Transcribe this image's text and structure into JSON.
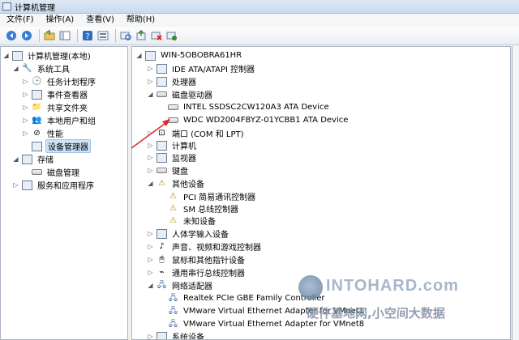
{
  "window": {
    "title": "计算机管理"
  },
  "menu": [
    "文件(F)",
    "操作(A)",
    "查看(V)",
    "帮助(H)"
  ],
  "toolbar": {
    "buttons": [
      "back-icon",
      "forward-icon",
      "up-folder-icon",
      "show-hide-tree-icon",
      "help-icon",
      "properties-icon",
      "scan-hardware-icon",
      "update-driver-icon",
      "disable-device-icon",
      "uninstall-device-icon"
    ]
  },
  "left_tree": [
    {
      "label": "计算机管理(本地)",
      "icon": "computer-icon",
      "expanded": true
    },
    {
      "label": "系统工具",
      "icon": "tools-icon",
      "expanded": true
    },
    {
      "label": "任务计划程序",
      "icon": "clock-icon"
    },
    {
      "label": "事件查看器",
      "icon": "event-viewer-icon"
    },
    {
      "label": "共享文件夹",
      "icon": "shared-folder-icon"
    },
    {
      "label": "本地用户和组",
      "icon": "users-icon"
    },
    {
      "label": "性能",
      "icon": "performance-icon"
    },
    {
      "label": "设备管理器",
      "icon": "device-manager-icon",
      "selected": true
    },
    {
      "label": "存储",
      "icon": "storage-icon",
      "expanded": true
    },
    {
      "label": "磁盘管理",
      "icon": "disk-management-icon"
    },
    {
      "label": "服务和应用程序",
      "icon": "services-icon"
    }
  ],
  "device_tree": [
    {
      "label": "WIN-5OBOBRA61HR",
      "icon": "computer-icon",
      "expanded": true
    },
    {
      "label": "IDE ATA/ATAPI 控制器",
      "icon": "ide-controller-icon"
    },
    {
      "label": "处理器",
      "icon": "processor-icon"
    },
    {
      "label": "磁盘驱动器",
      "icon": "disk-drive-icon",
      "expanded": true
    },
    {
      "label": "INTEL SSDSC2CW120A3 ATA Device",
      "icon": "drive-icon"
    },
    {
      "label": "WDC WD2004FBYZ-01YCBB1 ATA Device",
      "icon": "drive-icon"
    },
    {
      "label": "端口 (COM 和 LPT)",
      "icon": "port-icon"
    },
    {
      "label": "计算机",
      "icon": "computer-icon"
    },
    {
      "label": "监视器",
      "icon": "monitor-icon"
    },
    {
      "label": "键盘",
      "icon": "keyboard-icon"
    },
    {
      "label": "其他设备",
      "icon": "other-devices-icon",
      "expanded": true
    },
    {
      "label": "PCI 简易通讯控制器",
      "icon": "warning-device-icon"
    },
    {
      "label": "SM 总线控制器",
      "icon": "warning-device-icon"
    },
    {
      "label": "未知设备",
      "icon": "warning-device-icon"
    },
    {
      "label": "人体学输入设备",
      "icon": "hid-icon"
    },
    {
      "label": "声音、视频和游戏控制器",
      "icon": "sound-icon"
    },
    {
      "label": "鼠标和其他指针设备",
      "icon": "mouse-icon"
    },
    {
      "label": "通用串行总线控制器",
      "icon": "usb-icon"
    },
    {
      "label": "网络适配器",
      "icon": "network-adapter-icon",
      "expanded": true
    },
    {
      "label": "Realtek PCIe GBE Family Controller",
      "icon": "network-card-icon"
    },
    {
      "label": "VMware Virtual Ethernet Adapter for VMnet1",
      "icon": "network-card-icon"
    },
    {
      "label": "VMware Virtual Ethernet Adapter for VMnet8",
      "icon": "network-card-icon"
    },
    {
      "label": "系统设备",
      "icon": "system-devices-icon"
    }
  ],
  "watermark": {
    "brand": "INTOHARD.com",
    "slogan": "硬件基地网,小空间大数据"
  },
  "colors": {
    "selection": "#cde3f7",
    "annotation_arrow": "#d92b2b"
  }
}
